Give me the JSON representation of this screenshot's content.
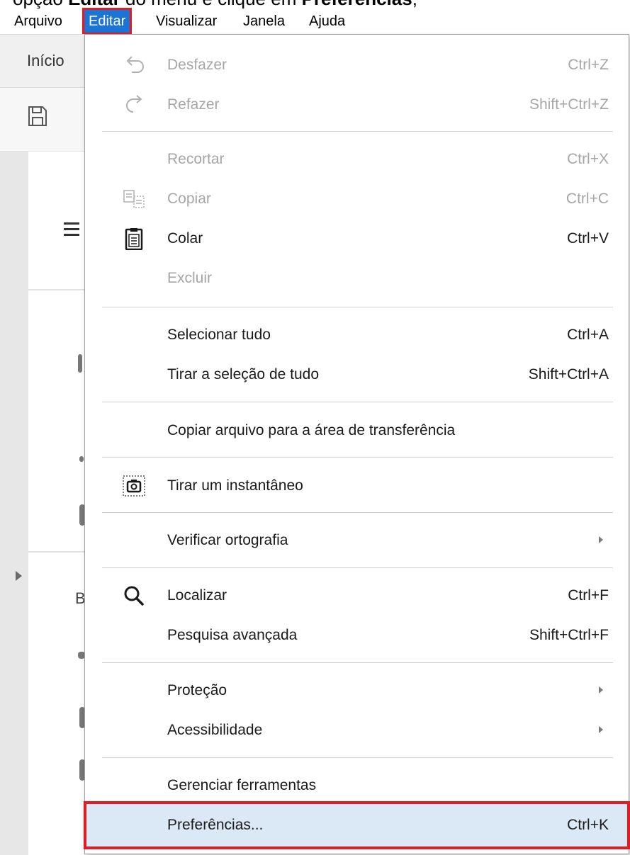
{
  "caption": {
    "pre": "opção ",
    "bold1": "Editar",
    "mid": " do menu e clique em ",
    "bold2": "Preferências",
    "post": ";"
  },
  "menubar": {
    "items": [
      "Arquivo",
      "Editar",
      "Visualizar",
      "Janela",
      "Ajuda"
    ],
    "active": "Editar"
  },
  "app": {
    "tab_label": "Início",
    "fragment_b": "B"
  },
  "edit_menu": {
    "items": [
      {
        "label": "Desfazer",
        "shortcut": "Ctrl+Z",
        "icon": "undo-icon",
        "enabled": false
      },
      {
        "label": "Refazer",
        "shortcut": "Shift+Ctrl+Z",
        "icon": "redo-icon",
        "enabled": false
      },
      {
        "label": "Recortar",
        "shortcut": "Ctrl+X",
        "icon": "",
        "enabled": false
      },
      {
        "label": "Copiar",
        "shortcut": "Ctrl+C",
        "icon": "copy-icon",
        "enabled": false
      },
      {
        "label": "Colar",
        "shortcut": "Ctrl+V",
        "icon": "clipboard-icon",
        "enabled": true
      },
      {
        "label": "Excluir",
        "shortcut": "",
        "icon": "",
        "enabled": false
      },
      {
        "label": "Selecionar tudo",
        "shortcut": "Ctrl+A",
        "icon": "",
        "enabled": true
      },
      {
        "label": "Tirar a seleção de tudo",
        "shortcut": "Shift+Ctrl+A",
        "icon": "",
        "enabled": true
      },
      {
        "label": "Copiar arquivo para a área de transferência",
        "shortcut": "",
        "icon": "",
        "enabled": true
      },
      {
        "label": "Tirar um instantâneo",
        "shortcut": "",
        "icon": "camera-icon",
        "enabled": true
      },
      {
        "label": "Verificar ortografia",
        "shortcut": "",
        "icon": "",
        "enabled": true,
        "submenu": true
      },
      {
        "label": "Localizar",
        "shortcut": "Ctrl+F",
        "icon": "magnifier-icon",
        "enabled": true
      },
      {
        "label": "Pesquisa avançada",
        "shortcut": "Shift+Ctrl+F",
        "icon": "",
        "enabled": true
      },
      {
        "label": "Proteção",
        "shortcut": "",
        "icon": "",
        "enabled": true,
        "submenu": true
      },
      {
        "label": "Acessibilidade",
        "shortcut": "",
        "icon": "",
        "enabled": true,
        "submenu": true
      },
      {
        "label": "Gerenciar ferramentas",
        "shortcut": "",
        "icon": "",
        "enabled": true
      },
      {
        "label": "Preferências...",
        "shortcut": "Ctrl+K",
        "icon": "",
        "enabled": true,
        "highlighted": true
      }
    ]
  },
  "colors": {
    "menubar_active": "#1c74d4",
    "highlight_outline": "#e31c24",
    "highlight_fill": "#dbe8f6",
    "disabled_text": "#a6a6a6"
  }
}
